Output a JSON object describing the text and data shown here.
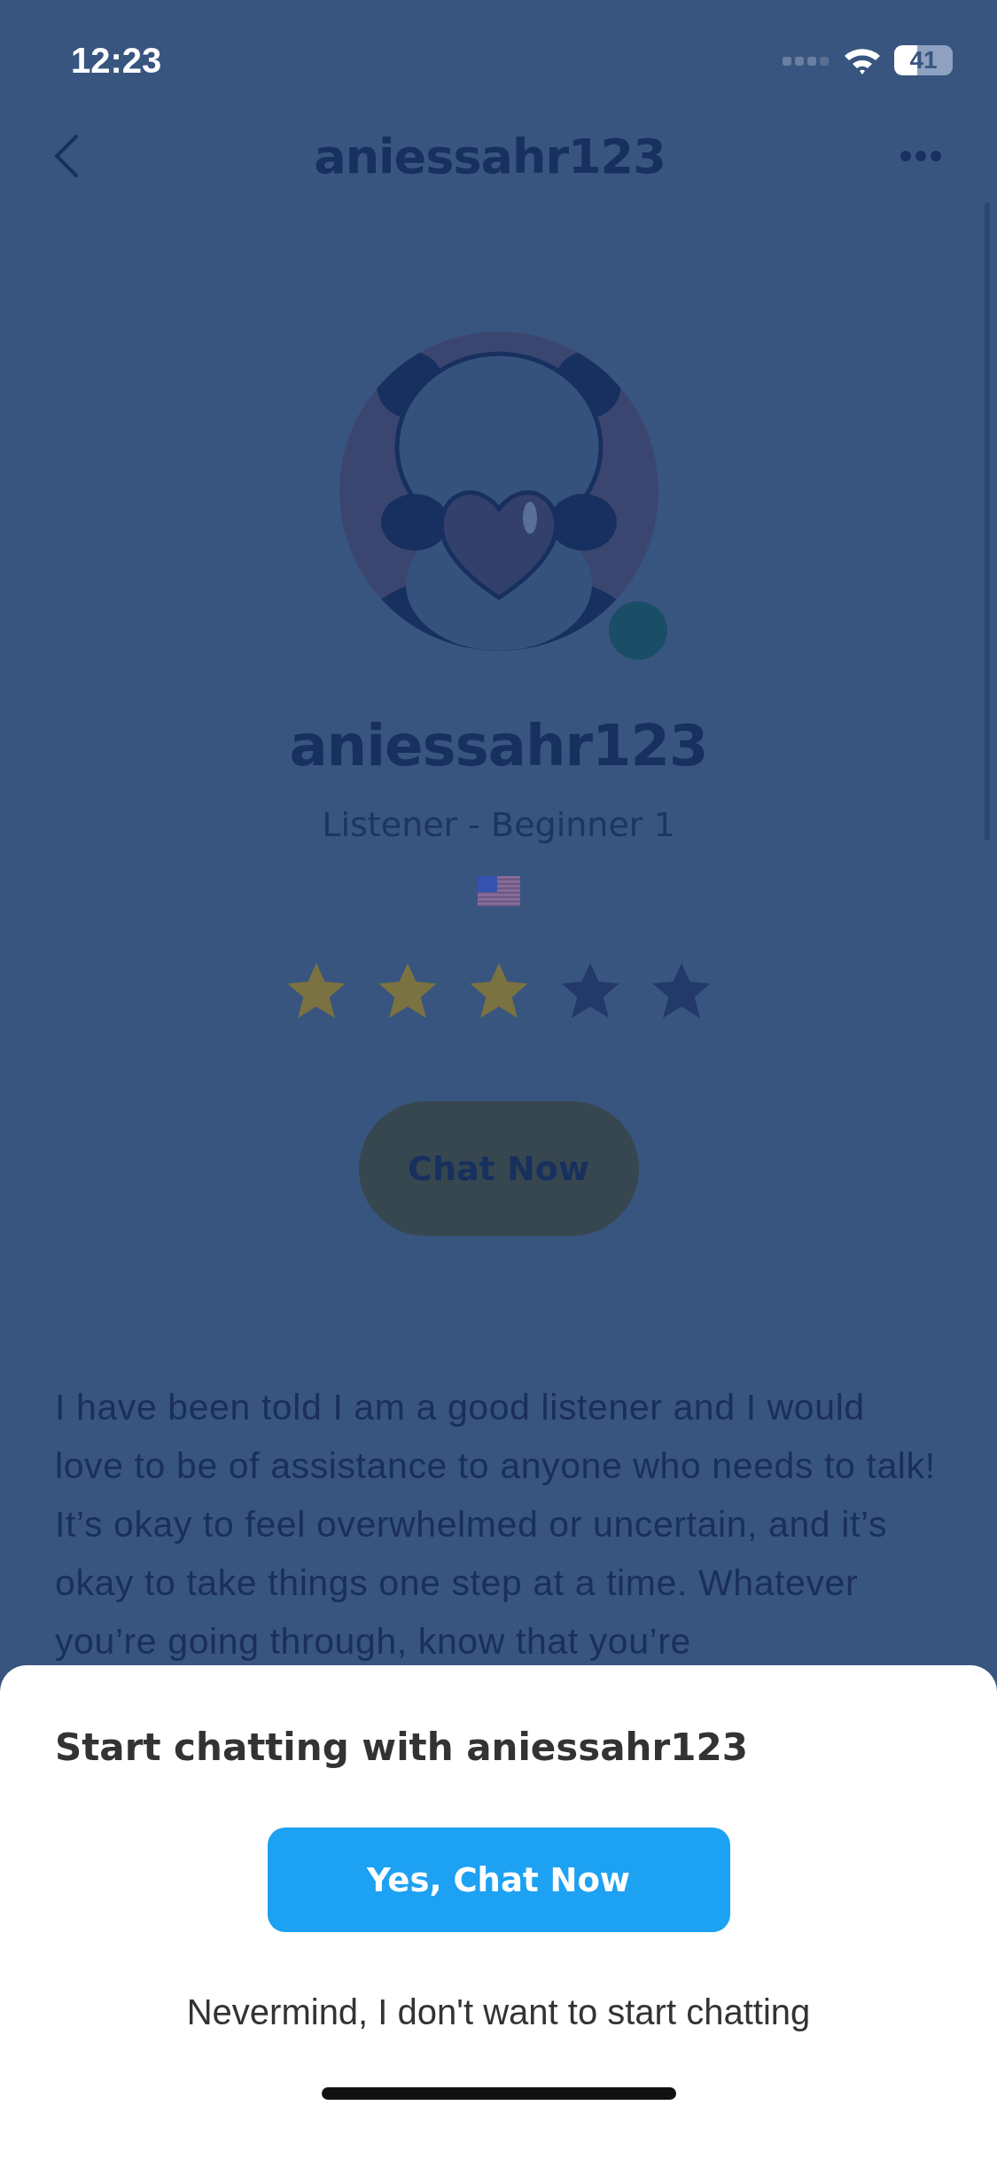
{
  "status_bar": {
    "time": "12:23",
    "battery": "41"
  },
  "nav": {
    "title": "aniessahr123"
  },
  "profile": {
    "online": true,
    "name": "aniessahr123",
    "role": "Listener - Beginner 1",
    "stars": 3,
    "button": "Chat Now"
  },
  "bio": "I have been told I am a good listener and I would love to be of assistance to anyone who needs to talk! It’s okay to feel overwhelmed or uncertain, and it’s okay to take things one step at a time. Whatever you’re going through, know that you’re",
  "sheet": {
    "title": "Start chatting with aniessahr123",
    "confirm": "Yes, Chat Now",
    "cancel": "Nevermind, I don't want to start chatting"
  }
}
